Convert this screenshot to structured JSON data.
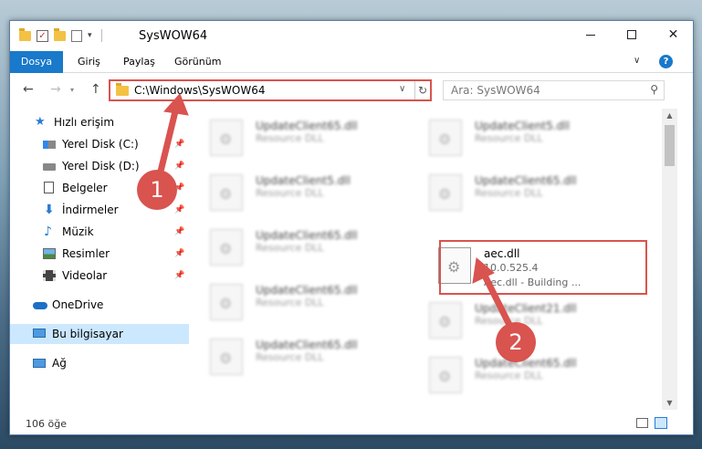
{
  "window": {
    "title": "SysWOW64",
    "minimize_label": "—",
    "close_label": "✕"
  },
  "ribbon": {
    "tabs": [
      "Dosya",
      "Giriş",
      "Paylaş",
      "Görünüm"
    ],
    "help_label": "?"
  },
  "nav": {
    "address": "C:\\Windows\\SysWOW64",
    "search_placeholder": "Ara: SysWOW64"
  },
  "sidebar": {
    "items": [
      {
        "label": "Hızlı erişim",
        "icon": "star-icon"
      },
      {
        "label": "Yerel Disk (C:)",
        "icon": "drive-icon",
        "pinned": true
      },
      {
        "label": "Yerel Disk (D:)",
        "icon": "drive-icon",
        "pinned": true
      },
      {
        "label": "Belgeler",
        "icon": "document-icon",
        "pinned": true
      },
      {
        "label": "İndirmeler",
        "icon": "download-icon",
        "pinned": true
      },
      {
        "label": "Müzik",
        "icon": "music-icon",
        "pinned": true
      },
      {
        "label": "Resimler",
        "icon": "pictures-icon",
        "pinned": true
      },
      {
        "label": "Videolar",
        "icon": "videos-icon",
        "pinned": true
      },
      {
        "label": "OneDrive",
        "icon": "cloud-icon"
      },
      {
        "label": "Bu bilgisayar",
        "icon": "computer-icon",
        "selected": true
      },
      {
        "label": "Ağ",
        "icon": "network-icon"
      }
    ]
  },
  "files": [
    {
      "name": "UpdateClient65.dll",
      "desc": "Resource DLL"
    },
    {
      "name": "UpdateClient5.dll",
      "desc": "Resource DLL"
    },
    {
      "name": "UpdateClient5.dll",
      "desc": "Resource DLL"
    },
    {
      "name": "UpdateClient65.dll",
      "desc": "Resource DLL"
    },
    {
      "name": "UpdateClient65.dll",
      "desc": "Resource DLL"
    },
    {
      "name": "aec.dll",
      "version": "10.0.525.4",
      "desc": "Aec.dll - Building ...",
      "highlighted": true
    },
    {
      "name": "UpdateClient65.dll",
      "desc": "Resource DLL"
    },
    {
      "name": "UpdateClient21.dll",
      "desc": "Resource DLL"
    },
    {
      "name": "UpdateClient65.dll",
      "desc": "Resource DLL"
    },
    {
      "name": "UpdateClient65.dll",
      "desc": "Resource DLL"
    }
  ],
  "status": {
    "item_count": "106 öğe"
  },
  "annotations": {
    "step1": "1",
    "step2": "2",
    "color": "#d9534f"
  }
}
